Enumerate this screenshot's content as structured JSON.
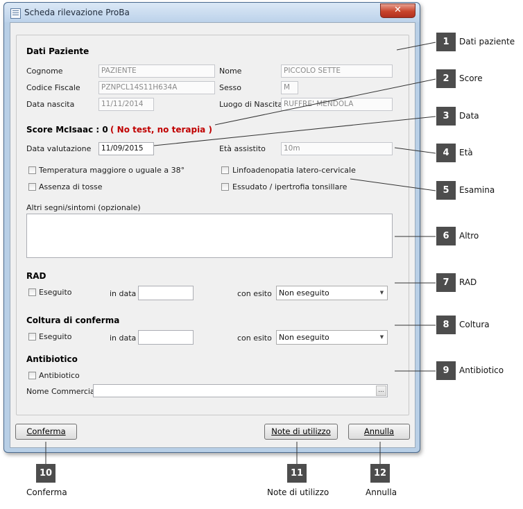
{
  "window": {
    "title": "Scheda rilevazione ProBa",
    "close_glyph": "✕"
  },
  "patient": {
    "heading": "Dati Paziente",
    "surname_label": "Cognome",
    "surname_value": "PAZIENTE",
    "name_label": "Nome",
    "name_value": "PICCOLO SETTE",
    "fiscal_code_label": "Codice Fiscale",
    "fiscal_code_value": "PZNPCL14S11H634A",
    "sex_label": "Sesso",
    "sex_value": "M",
    "birth_date_label": "Data nascita",
    "birth_date_value": "11/11/2014",
    "birth_place_label": "Luogo di Nascita",
    "birth_place_value": "RUFFRE' MENDOLA"
  },
  "score": {
    "label": "Score McIsaac : 0",
    "message": "( No test, no terapia )"
  },
  "evaluation": {
    "date_label": "Data valutazione",
    "date_value": "11/09/2015",
    "age_label": "Età assistito",
    "age_value": "10m"
  },
  "symptoms": {
    "fever": "Temperatura maggiore o uguale a 38°",
    "lymph": "Linfoadenopatia latero-cervicale",
    "no_cough": "Assenza di tosse",
    "exudate": "Essudato / ipertrofia tonsillare",
    "other_label": "Altri segni/sintomi (opzionale)",
    "other_value": ""
  },
  "rad": {
    "heading": "RAD",
    "done_label": "Eseguito",
    "date_label": "in data",
    "date_value": "",
    "result_label": "con esito",
    "result_value": "Non eseguito"
  },
  "culture": {
    "heading": "Coltura di conferma",
    "done_label": "Eseguito",
    "date_label": "in data",
    "date_value": "",
    "result_label": "con esito",
    "result_value": "Non eseguito"
  },
  "antibiotic": {
    "heading": "Antibiotico",
    "check_label": "Antibiotico",
    "commercial_name_label": "Nome Commerciale",
    "commercial_name_value": "",
    "browse_label": "..."
  },
  "buttons": {
    "confirm": "Conferma",
    "notes": "Note di utilizzo",
    "cancel": "Annulla"
  },
  "callouts": [
    {
      "num": "1",
      "label": "Dati paziente"
    },
    {
      "num": "2",
      "label": "Score"
    },
    {
      "num": "3",
      "label": "Data"
    },
    {
      "num": "4",
      "label": "Età"
    },
    {
      "num": "5",
      "label": "Esamina"
    },
    {
      "num": "6",
      "label": "Altro"
    },
    {
      "num": "7",
      "label": "RAD"
    },
    {
      "num": "8",
      "label": "Coltura"
    },
    {
      "num": "9",
      "label": "Antibiotico"
    },
    {
      "num": "10",
      "label": "Conferma"
    },
    {
      "num": "11",
      "label": "Note di utilizzo"
    },
    {
      "num": "12",
      "label": "Annulla"
    }
  ],
  "colors": {
    "accent_red": "#c00000",
    "badge": "#4d4d4d"
  }
}
